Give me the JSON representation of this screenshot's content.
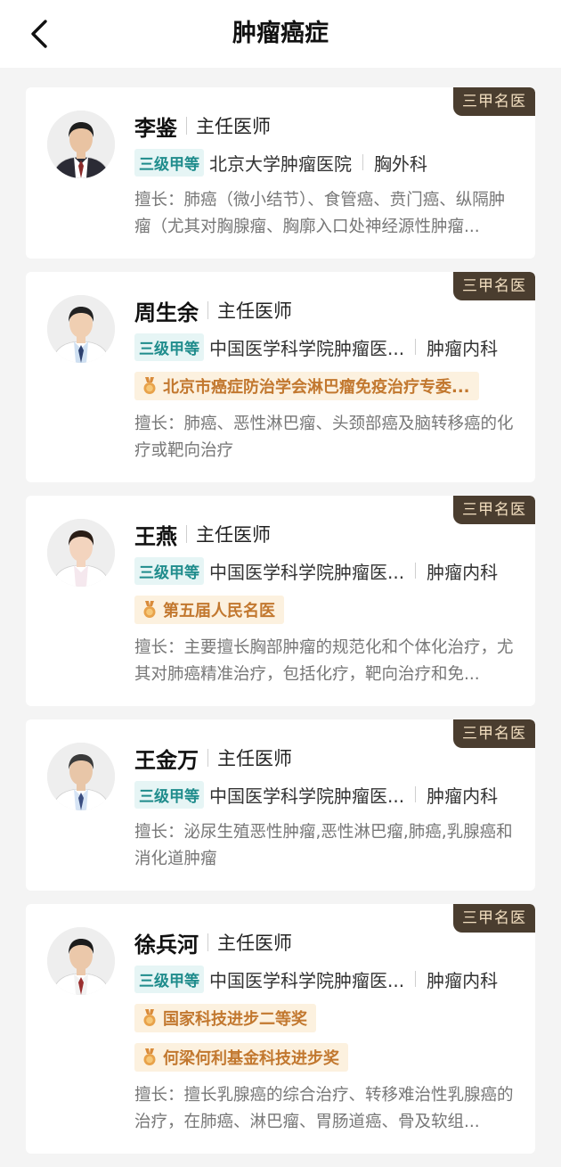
{
  "header": {
    "title": "肿瘤癌症"
  },
  "colors": {
    "corner_tag_bg": "#4a3d2f",
    "corner_tag_text": "#f3dfc0",
    "level_tag_bg": "#e6f5f5",
    "level_tag_text": "#1f8c8c",
    "honor_bg": "#fcf1df",
    "honor_text": "#c2782f"
  },
  "doctors": [
    {
      "tag": "三甲名医",
      "name": "李鉴",
      "title": "主任医师",
      "level": "三级甲等",
      "hospital": "北京大学肿瘤医院",
      "dept": "胸外科",
      "honors": [],
      "expertise": "擅长：肺癌（微小结节）、食管癌、贲门癌、纵隔肿瘤（尤其对胸腺瘤、胸廓入口处神经源性肿瘤..."
    },
    {
      "tag": "三甲名医",
      "name": "周生余",
      "title": "主任医师",
      "level": "三级甲等",
      "hospital": "中国医学科学院肿瘤医...",
      "dept": "肿瘤内科",
      "honors": [
        "北京市癌症防治学会淋巴瘤免疫治疗专委..."
      ],
      "expertise": "擅长：肺癌、恶性淋巴瘤、头颈部癌及脑转移癌的化疗或靶向治疗"
    },
    {
      "tag": "三甲名医",
      "name": "王燕",
      "title": "主任医师",
      "level": "三级甲等",
      "hospital": "中国医学科学院肿瘤医...",
      "dept": "肿瘤内科",
      "honors": [
        "第五届人民名医"
      ],
      "expertise": "擅长：主要擅长胸部肿瘤的规范化和个体化治疗，尤其对肺癌精准治疗，包括化疗，靶向治疗和免..."
    },
    {
      "tag": "三甲名医",
      "name": "王金万",
      "title": "主任医师",
      "level": "三级甲等",
      "hospital": "中国医学科学院肿瘤医...",
      "dept": "肿瘤内科",
      "honors": [],
      "expertise": "擅长：泌尿生殖恶性肿瘤,恶性淋巴瘤,肺癌,乳腺癌和消化道肿瘤"
    },
    {
      "tag": "三甲名医",
      "name": "徐兵河",
      "title": "主任医师",
      "level": "三级甲等",
      "hospital": "中国医学科学院肿瘤医...",
      "dept": "肿瘤内科",
      "honors": [
        "国家科技进步二等奖",
        "何梁何利基金科技进步奖"
      ],
      "expertise": "擅长：擅长乳腺癌的综合治疗、转移难治性乳腺癌的治疗，在肺癌、淋巴瘤、胃肠道癌、骨及软组..."
    }
  ]
}
